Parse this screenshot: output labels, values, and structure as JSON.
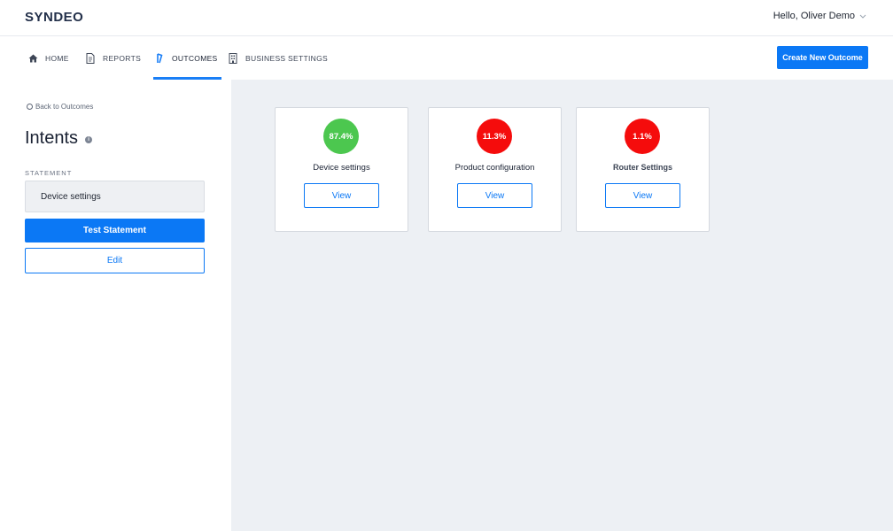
{
  "app": {
    "logo": "SYNDEO",
    "user_greeting": "Hello, Oliver Demo"
  },
  "nav": {
    "items": [
      {
        "label": "HOME",
        "icon": "home-icon"
      },
      {
        "label": "REPORTS",
        "icon": "document-icon"
      },
      {
        "label": "OUTCOMES",
        "icon": "outcomes-icon",
        "active": true
      },
      {
        "label": "BUSINESS SETTINGS",
        "icon": "building-icon"
      }
    ],
    "create_button": "Create New Outcome"
  },
  "sidebar": {
    "back_link": "Back to Outcomes",
    "title": "Intents",
    "statement_label": "STATEMENT",
    "statement_value": "Device settings",
    "test_button": "Test Statement",
    "edit_button": "Edit"
  },
  "outcomes": [
    {
      "name": "Device settings",
      "percent": "87.4%",
      "color": "#4cc74f",
      "view_label": "View"
    },
    {
      "name": "Product configuration",
      "percent": "11.3%",
      "color": "#f50c0c",
      "view_label": "View"
    },
    {
      "name": "Router Settings",
      "percent": "1.1%",
      "color": "#f50c0c",
      "view_label": "View"
    }
  ],
  "colors": {
    "accent": "#0b78f5",
    "success": "#4cc74f",
    "danger": "#f50c0c",
    "main_bg": "#edf0f4"
  }
}
